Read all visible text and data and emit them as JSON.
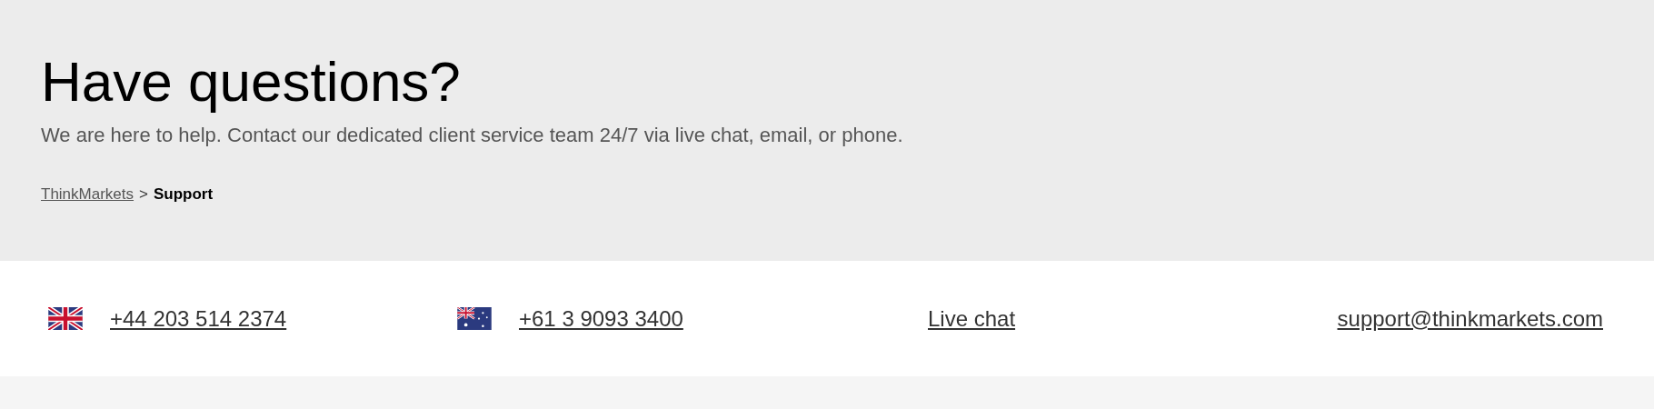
{
  "hero": {
    "title": "Have questions?",
    "subtitle": "We are here to help. Contact our dedicated client service team 24/7 via live chat, email, or phone."
  },
  "breadcrumb": [
    {
      "label": "ThinkMarkets",
      "selected": false
    },
    {
      "label": ">",
      "kind": "separator"
    },
    {
      "label": "Support",
      "selected": true
    }
  ],
  "contacts": [
    {
      "kind": "phone_gb",
      "label": "+44 203 514 2374"
    },
    {
      "kind": "phone_au",
      "label": "+61 3 9093 3400"
    },
    {
      "kind": "link",
      "label": "Live chat"
    },
    {
      "kind": "link",
      "label": "support@thinkmarkets.com"
    }
  ]
}
